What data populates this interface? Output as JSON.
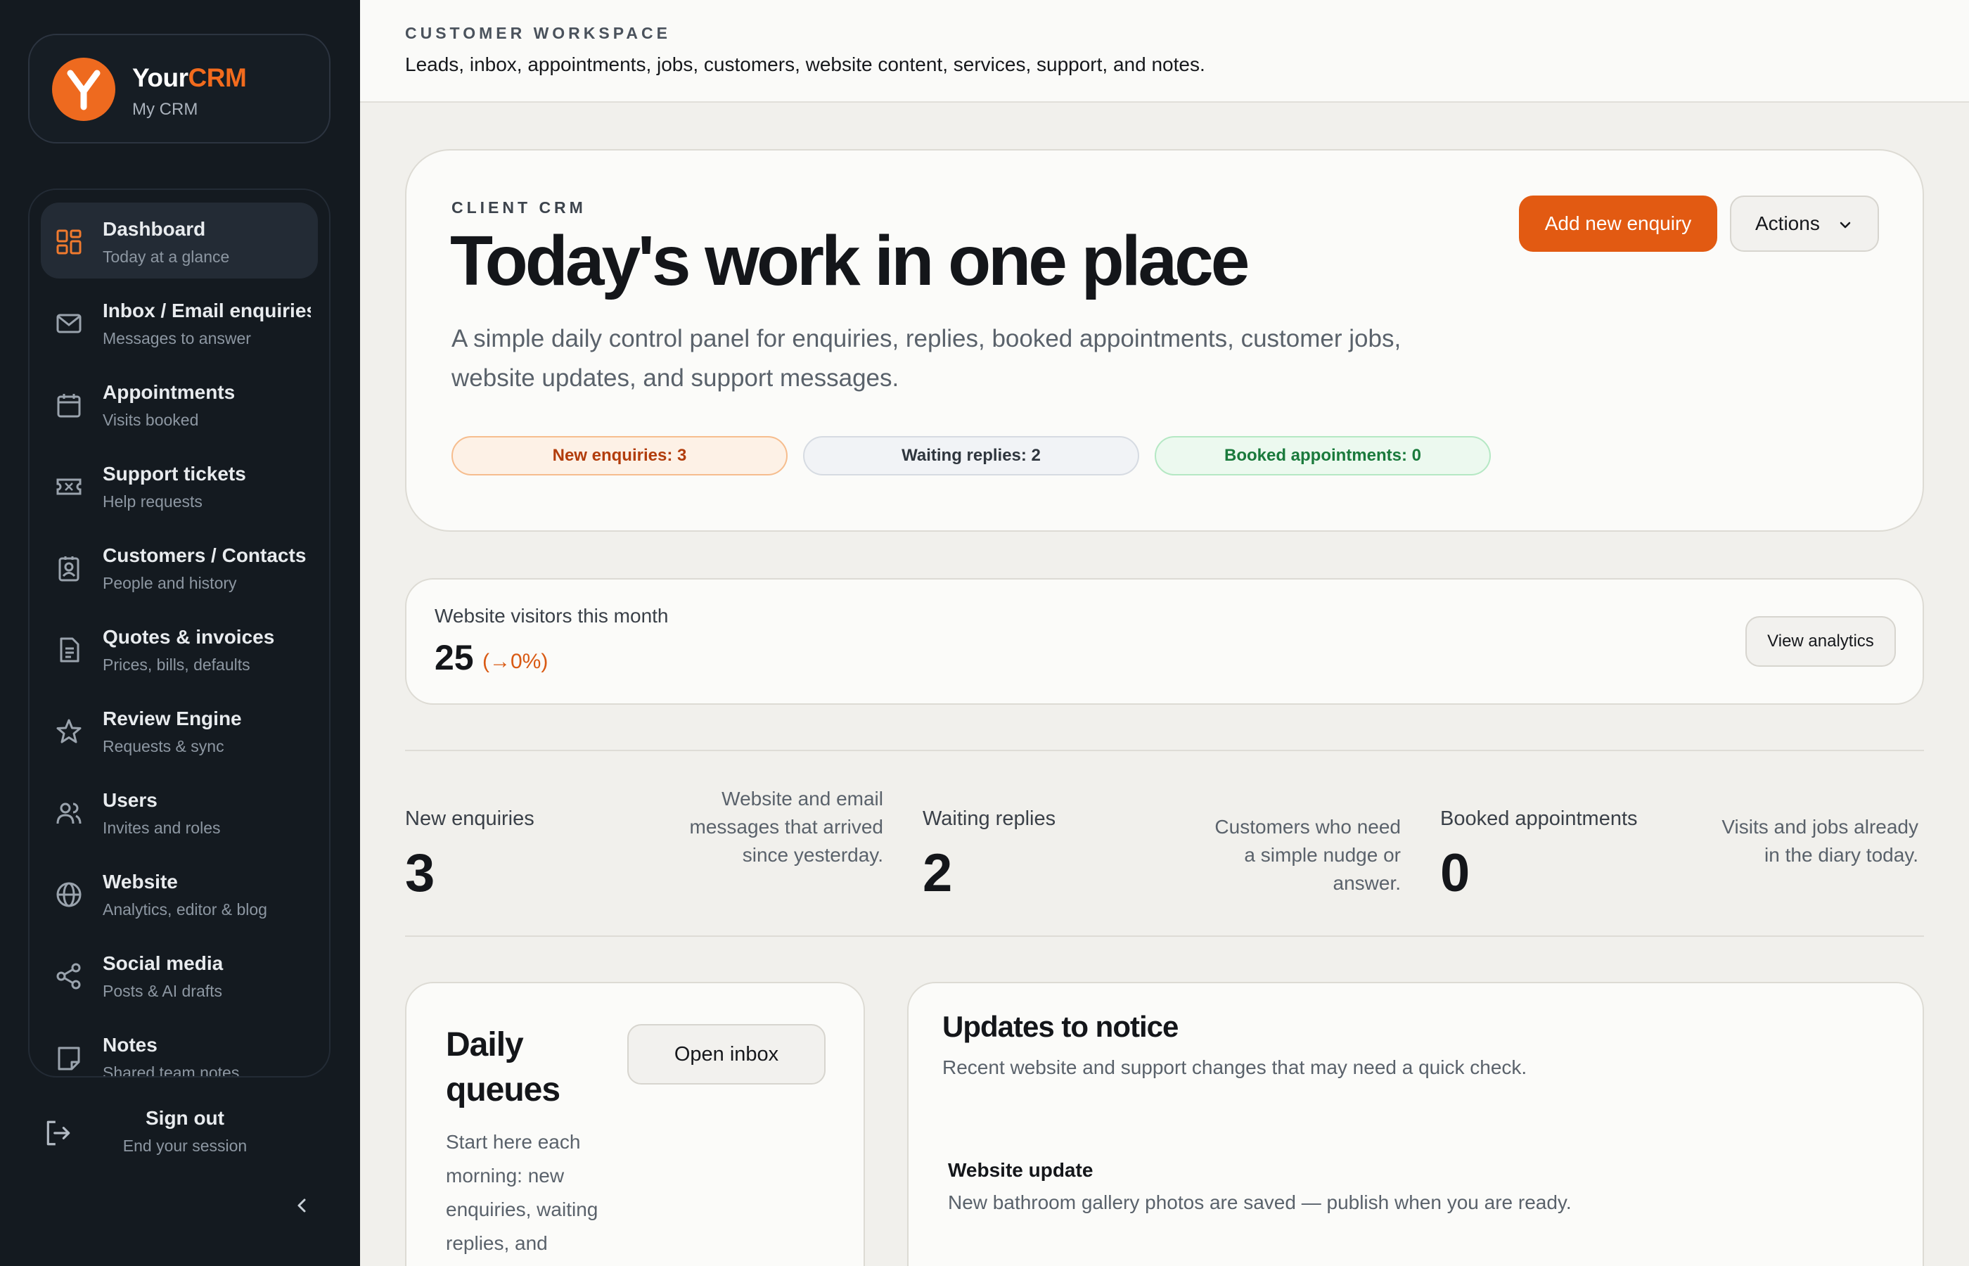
{
  "brand": {
    "name_part1": "Your",
    "name_part2": "CRM",
    "subtitle": "My CRM",
    "logo_letter": "Y",
    "accent_color": "#f26b1d"
  },
  "sidebar": {
    "items": [
      {
        "label": "Dashboard",
        "sub": "Today at a glance",
        "icon": "dashboard-grid-icon",
        "active": true
      },
      {
        "label": "Inbox / Email enquiries",
        "sub": "Messages to answer",
        "icon": "mail-icon"
      },
      {
        "label": "Appointments",
        "sub": "Visits booked",
        "icon": "calendar-icon"
      },
      {
        "label": "Support tickets",
        "sub": "Help requests",
        "icon": "ticket-icon"
      },
      {
        "label": "Customers / Contacts",
        "sub": "People and history",
        "icon": "contact-card-icon"
      },
      {
        "label": "Quotes & invoices",
        "sub": "Prices, bills, defaults",
        "icon": "document-icon"
      },
      {
        "label": "Review Engine",
        "sub": "Requests & sync",
        "icon": "star-icon"
      },
      {
        "label": "Users",
        "sub": "Invites and roles",
        "icon": "users-icon"
      },
      {
        "label": "Website",
        "sub": "Analytics, editor & blog",
        "icon": "globe-icon"
      },
      {
        "label": "Social media",
        "sub": "Posts & AI drafts",
        "icon": "share-icon"
      },
      {
        "label": "Notes",
        "sub": "Shared team notes",
        "icon": "note-icon"
      }
    ],
    "signout": {
      "label": "Sign out",
      "sub": "End your session",
      "icon": "logout-icon"
    },
    "collapse_icon": "chevron-left-icon"
  },
  "header": {
    "eyebrow": "CUSTOMER WORKSPACE",
    "description": "Leads, inbox, appointments, jobs, customers, website content, services, support, and notes."
  },
  "hero": {
    "eyebrow": "CLIENT CRM",
    "title": "Today's work in one place",
    "description": "A simple daily control panel for enquiries, replies, booked appointments, customer jobs, website updates, and support messages.",
    "pills": {
      "new_enquiries": "New enquiries: 3",
      "waiting_replies": "Waiting replies: 2",
      "booked_appointments": "Booked appointments: 0"
    },
    "primary_button": "Add new enquiry",
    "actions_button": "Actions"
  },
  "visitors": {
    "label": "Website visitors this month",
    "value": "25",
    "change": "(→0%)",
    "button": "View analytics"
  },
  "stats": [
    {
      "label": "New enquiries",
      "value": "3",
      "desc": "Website and email messages that arrived since yesterday."
    },
    {
      "label": "Waiting replies",
      "value": "2",
      "desc": "Customers who need a simple nudge or answer."
    },
    {
      "label": "Booked appointments",
      "value": "0",
      "desc": "Visits and jobs already in the diary today."
    }
  ],
  "queues": {
    "title": "Daily queues",
    "description": "Start here each morning: new enquiries, waiting replies, and",
    "button": "Open inbox"
  },
  "updates": {
    "title": "Updates to notice",
    "description": "Recent website and support changes that may need a quick check.",
    "items": [
      {
        "title": "Website update",
        "text": "New bathroom gallery photos are saved — publish when you are ready."
      }
    ]
  }
}
